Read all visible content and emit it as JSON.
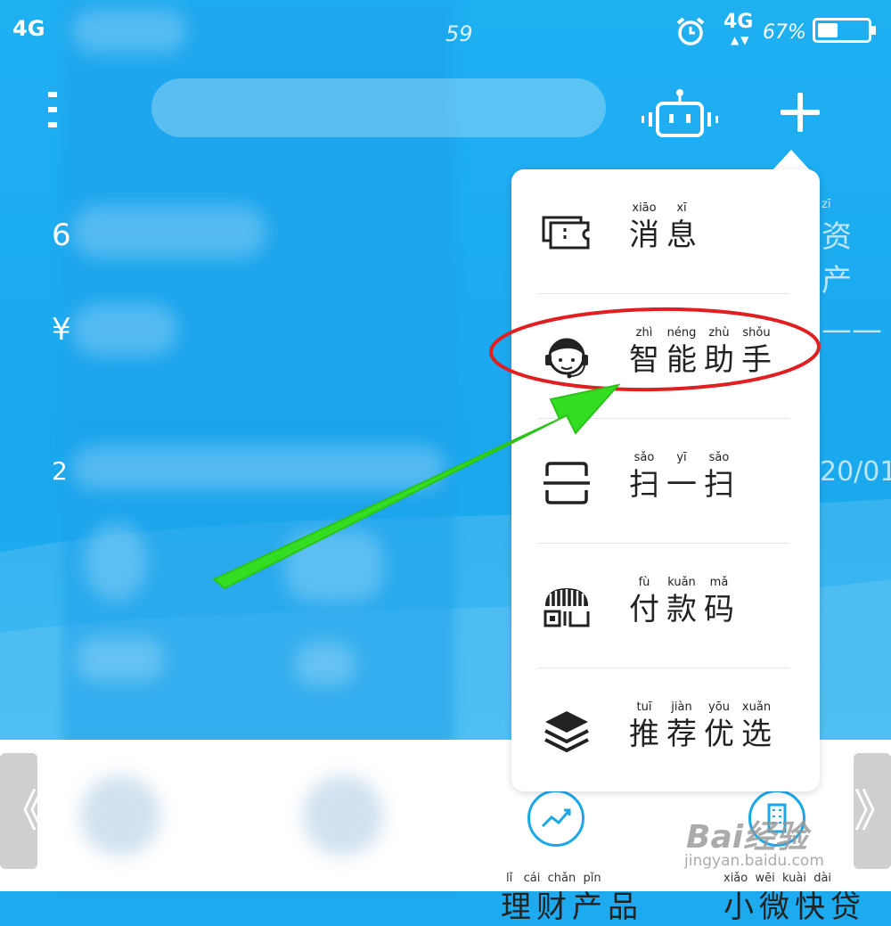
{
  "status_bar": {
    "network_left": "4G",
    "time": "59",
    "network_right": "4G",
    "network_arrows": "▲▼",
    "battery": "67%",
    "battery_level": 0.36
  },
  "header": {
    "menu_icon": "menu-icon",
    "robot_icon": "robot-icon",
    "plus_icon": "plus-icon"
  },
  "background_fragments": {
    "assets_text": "资产",
    "assets_pinyin": "zī",
    "dash": "——",
    "date_fragment": "20/01",
    "left_char_1": "6",
    "left_char_2": "¥",
    "left_char_3": "2"
  },
  "popup_menu": {
    "items": [
      {
        "icon": "ticket-icon",
        "chars": [
          {
            "py": "xiāo",
            "hz": "消"
          },
          {
            "py": "xī",
            "hz": "息"
          }
        ]
      },
      {
        "icon": "headset-icon",
        "chars": [
          {
            "py": "zhì",
            "hz": "智"
          },
          {
            "py": "néng",
            "hz": "能"
          },
          {
            "py": "zhù",
            "hz": "助"
          },
          {
            "py": "shǒu",
            "hz": "手"
          }
        ]
      },
      {
        "icon": "scan-icon",
        "chars": [
          {
            "py": "sǎo",
            "hz": "扫"
          },
          {
            "py": "yī",
            "hz": "一"
          },
          {
            "py": "sǎo",
            "hz": "扫"
          }
        ]
      },
      {
        "icon": "pay-code-icon",
        "chars": [
          {
            "py": "fù",
            "hz": "付"
          },
          {
            "py": "kuǎn",
            "hz": "款"
          },
          {
            "py": "mǎ",
            "hz": "码"
          }
        ]
      },
      {
        "icon": "layers-icon",
        "chars": [
          {
            "py": "tuī",
            "hz": "推"
          },
          {
            "py": "jiàn",
            "hz": "荐"
          },
          {
            "py": "yōu",
            "hz": "优"
          },
          {
            "py": "xuǎn",
            "hz": "选"
          }
        ]
      }
    ]
  },
  "bottom_products": [
    {
      "icon": "trend-icon",
      "label": "理财产品",
      "pinyin": "lǐ   cái  chǎn  pǐn"
    },
    {
      "icon": "building-icon",
      "label": "小微快贷",
      "pinyin": "xiǎo  wēi  kuài  dài"
    }
  ],
  "nav": {
    "prev": "《",
    "next": "》"
  },
  "watermark": {
    "brand": "Bai经验",
    "url": "jingyan.baidu.com"
  },
  "annotation": {
    "highlight_color": "#e02020",
    "arrow_color": "#33dd22"
  }
}
